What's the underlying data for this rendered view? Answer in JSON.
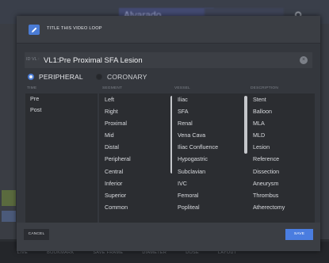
{
  "background": {
    "title": "Alvarado",
    "bottom_bar": [
      "LIVE",
      "BOOKMARK",
      "SAVE FRAME",
      "DIAMETER",
      "DOSE",
      "LAYOUT"
    ]
  },
  "modal": {
    "header_title": "TITLE THIS VIDEO LOOP",
    "field": {
      "prefix": "ID VL :",
      "value": "VL1:Pre Proximal SFA Lesion"
    },
    "radios": [
      {
        "label": "PERIPHERAL",
        "selected": true
      },
      {
        "label": "CORONARY",
        "selected": false
      }
    ],
    "columns": {
      "time": {
        "header": "TIME",
        "items": [
          "Pre",
          "Post"
        ]
      },
      "segment": {
        "header": "SEGMENT",
        "items": [
          "Left",
          "Right",
          "Proximal",
          "Mid",
          "Distal",
          "Peripheral",
          "Central",
          "Inferior",
          "Superior",
          "Common"
        ]
      },
      "vessel": {
        "header": "VESSEL",
        "items": [
          "Iliac",
          "SFA",
          "Renal",
          "Vena Cava",
          "Iliac Confluence",
          "Hypogastric",
          "Subclavian",
          "IVC",
          "Femoral",
          "Popliteal"
        ]
      },
      "description": {
        "header": "DESCRIPTION",
        "items": [
          "Stent",
          "Balloon",
          "MLA",
          "MLD",
          "Lesion",
          "Reference",
          "Dissection",
          "Aneurysm",
          "Thrombus",
          "Atherectomy"
        ]
      }
    },
    "cancel_label": "CANCEL",
    "save_label": "SAVE"
  }
}
